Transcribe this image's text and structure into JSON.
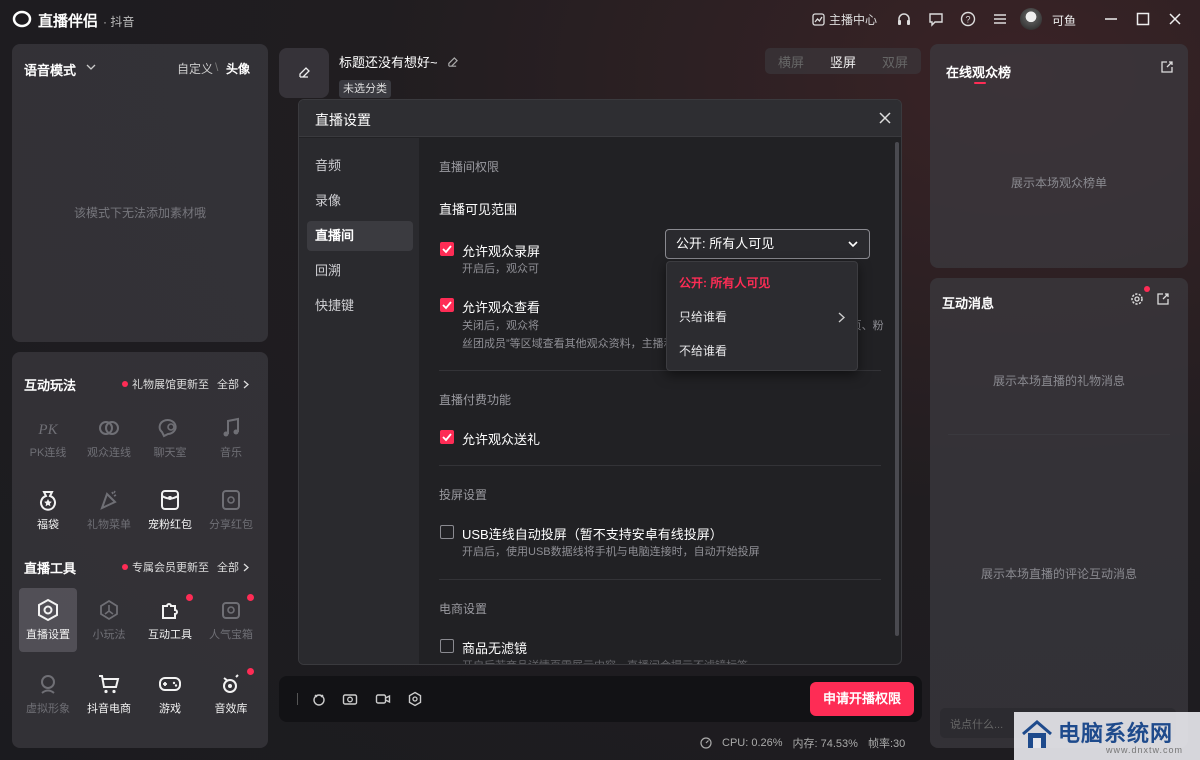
{
  "app": {
    "name": "直播伴侣",
    "sub": "· 抖音"
  },
  "titlebar": {
    "anchor_center": "主播中心",
    "user_name": "可鱼"
  },
  "voice_panel": {
    "title": "语音模式",
    "custom": "自定义",
    "sep": "\\",
    "head": "头像",
    "empty": "该模式下无法添加素材哦"
  },
  "interactive": {
    "title": "互动玩法",
    "note": "礼物展馆更新至",
    "all": "全部",
    "items": [
      {
        "label": "PK连线",
        "icon": "pk-icon"
      },
      {
        "label": "观众连线",
        "icon": "link-icon"
      },
      {
        "label": "聊天室",
        "icon": "chat-room-icon"
      },
      {
        "label": "音乐",
        "icon": "music-icon"
      },
      {
        "label": "福袋",
        "icon": "lucky-bag-icon"
      },
      {
        "label": "礼物菜单",
        "icon": "gift-menu-icon"
      },
      {
        "label": "宠粉红包",
        "icon": "red-packet-icon"
      },
      {
        "label": "分享红包",
        "icon": "share-packet-icon"
      }
    ]
  },
  "live_tools": {
    "title": "直播工具",
    "note": "专属会员更新至",
    "all": "全部",
    "items": [
      {
        "label": "直播设置",
        "icon": "settings-hex-icon"
      },
      {
        "label": "小玩法",
        "icon": "mini-game-icon"
      },
      {
        "label": "互动工具",
        "icon": "puzzle-icon"
      },
      {
        "label": "人气宝箱",
        "icon": "treasure-icon"
      },
      {
        "label": "虚拟形象",
        "icon": "avatar-icon"
      },
      {
        "label": "抖音电商",
        "icon": "cart-icon"
      },
      {
        "label": "游戏",
        "icon": "gamepad-icon"
      },
      {
        "label": "音效库",
        "icon": "sound-fx-icon"
      }
    ]
  },
  "stage": {
    "title": "标题还没有想好~",
    "category": "未选分类",
    "orient": [
      "横屏",
      "竖屏",
      "双屏"
    ]
  },
  "rank": {
    "title": "在线观众榜",
    "empty": "展示本场观众榜单"
  },
  "messages": {
    "title": "互动消息",
    "gift_empty": "展示本场直播的礼物消息",
    "comment_empty": "展示本场直播的评论互动消息",
    "input_placeholder": "说点什么..."
  },
  "bottom": {
    "apply": "申请开播权限",
    "cpu": "CPU: 0.26%",
    "mem": "内存: 74.53%",
    "fps": "帧率:30"
  },
  "modal": {
    "title": "直播设置",
    "nav": [
      "音频",
      "录像",
      "直播间",
      "回溯",
      "快捷键"
    ],
    "perm_head": "直播间权限",
    "visibility_label": "直播可见范围",
    "visibility_value": "公开: 所有人可见",
    "dropdown": [
      "公开: 所有人可见",
      "只给谁看",
      "不给谁看"
    ],
    "rec_label": "允许观众录屏",
    "rec_desc": "开启后，观众可",
    "view_label": "允许观众查看",
    "view_desc_1": "关闭后，观众将",
    "view_desc_1b": "ok贡献榜、福袋开奖页、粉",
    "view_desc_2": "丝团成员”等区域查看其他观众资料，主播和管理员可正常查看观众资料",
    "pay_head": "直播付费功能",
    "gift_label": "允许观众送礼",
    "cast_head": "投屏设置",
    "usb_label": "USB连线自动投屏（暂不支持安卓有线投屏）",
    "usb_desc": "开启后，使用USB数据线将手机与电脑连接时，自动开始投屏",
    "ecom_head": "电商设置",
    "filter_label": "商品无滤镜",
    "filter_desc": "开启后若商品详情页需展示内容，直播间会提示不滤镜标签"
  },
  "watermark": {
    "text": "电脑系统网",
    "url": "www.dnxtw.com"
  }
}
